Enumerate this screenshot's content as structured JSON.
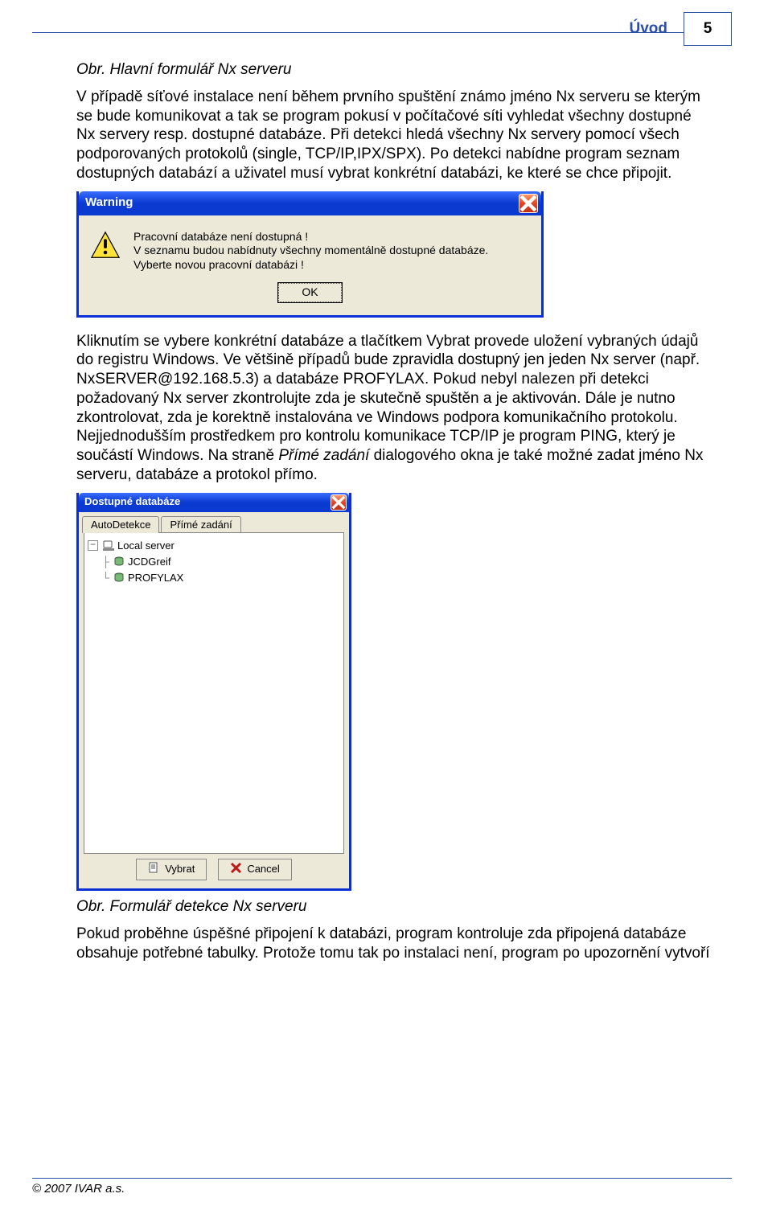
{
  "header": {
    "section": "Úvod",
    "page_number": "5"
  },
  "body": {
    "caption1": "Obr. Hlavní formulář Nx serveru",
    "para1": "V případě síťové instalace není během prvního spuštění známo jméno Nx serveru se kterým se bude komunikovat a tak se program pokusí v počítačové síti vyhledat všechny dostupné Nx servery resp. dostupné databáze. Při detekci hledá všechny Nx servery pomocí všech podporovaných protokolů (single, TCP/IP,IPX/SPX). Po detekci nabídne program seznam dostupných databází a uživatel musí vybrat konkrétní databázi, ke které se chce připojit.",
    "para2_a": "Kliknutím se vybere konkrétní databáze a tlačítkem Vybrat provede uložení vybraných údajů do registru Windows. Ve většině případů bude zpravidla dostupný jen jeden Nx server (např. NxSERVER@192.168.5.3) a databáze PROFYLAX. Pokud nebyl nalezen při detekci požadovaný Nx server zkontrolujte zda je skutečně spuštěn a je aktivován. Dále je nutno zkontrolovat, zda je korektně instalována ve Windows podpora komunikačního protokolu. Nejjednodušším prostředkem pro kontrolu komunikace TCP/IP je program PING, který je součástí Windows. Na straně ",
    "para2_i": "Přímé zadání",
    "para2_b": " dialogového okna je také možné zadat jméno Nx serveru, databáze a protokol přímo.",
    "caption2": "Obr. Formulář detekce Nx serveru",
    "para3": "Pokud proběhne úspěšné připojení k databázi, program kontroluje zda připojená databáze obsahuje potřebné tabulky. Protože tomu tak po instalaci není, program po upozornění vytvoří"
  },
  "warning_dialog": {
    "title": "Warning",
    "line1": "Pracovní databáze není dostupná !",
    "line2": "V seznamu budou nabídnuty všechny momentálně dostupné databáze.",
    "line3": "Vyberte novou pracovní databázi !",
    "ok": "OK"
  },
  "db_dialog": {
    "title": "Dostupné databáze",
    "tabs": {
      "auto": "AutoDetekce",
      "direct": "Přímé zadání"
    },
    "tree": {
      "root": "Local server",
      "items": [
        "JCDGreif",
        "PROFYLAX"
      ]
    },
    "buttons": {
      "select": "Vybrat",
      "cancel": "Cancel"
    }
  },
  "footer": "© 2007 IVAR a.s."
}
